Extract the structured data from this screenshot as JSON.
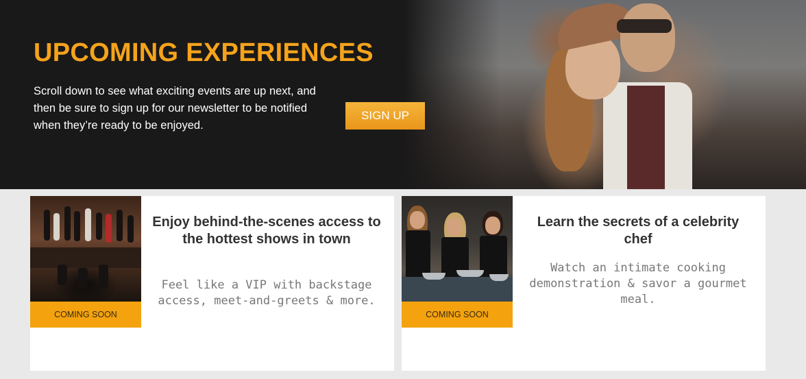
{
  "hero": {
    "title": "UPCOMING EXPERIENCES",
    "description": "Scroll down to see what exciting events are up next, and then be sure to sign up for our newsletter to be notified when they’re ready to be enjoyed.",
    "signup_label": "SIGN UP",
    "accent_color": "#f5a31c"
  },
  "cards": [
    {
      "badge": "COMING SOON",
      "title": "Enjoy behind-the-scenes access to the hottest shows in town",
      "description": "Feel like a VIP with backstage access, meet-and-greets & more."
    },
    {
      "badge": "COMING SOON",
      "title": "Learn the secrets of a celebrity chef",
      "description": "Watch an intimate cooking demonstration & savor a gourmet meal."
    }
  ]
}
